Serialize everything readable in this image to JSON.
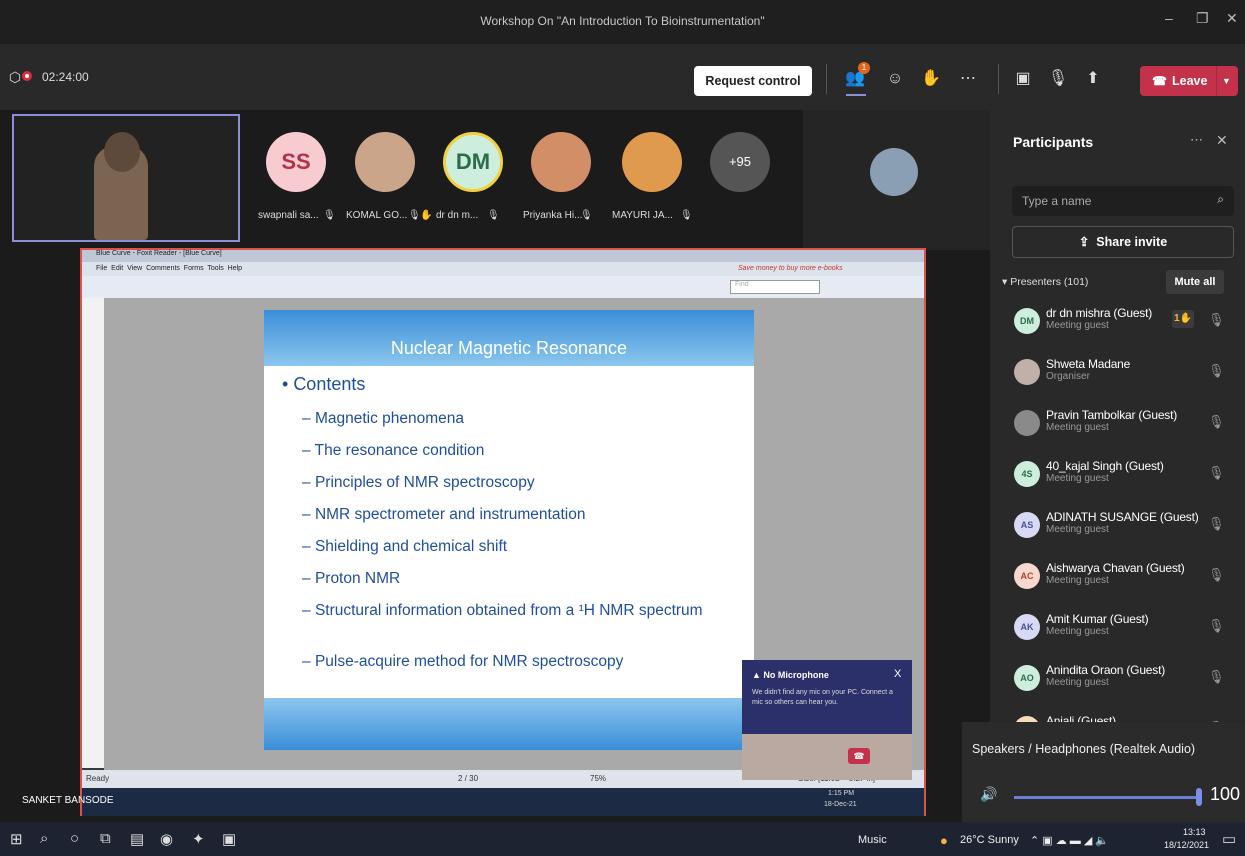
{
  "window": {
    "title": "Workshop On \"An Introduction To Bioinstrumentation\""
  },
  "toolbar": {
    "timer": "02:24:00",
    "request_control": "Request control",
    "leave": "Leave",
    "participants_badge": "1"
  },
  "gallery": {
    "tiles": [
      {
        "initials": "SS",
        "name": "swapnali sa...",
        "bg": "#f8cbd1",
        "fg": "#b0334a"
      },
      {
        "initials": "",
        "name": "KOMAL GO...",
        "bg": "#caa58a",
        "fg": "#fff"
      },
      {
        "initials": "DM",
        "name": "dr dn m...",
        "bg": "#cdeedd",
        "fg": "#2e6b4a"
      },
      {
        "initials": "",
        "name": "Priyanka Hi...",
        "bg": "#d28e66",
        "fg": "#fff"
      },
      {
        "initials": "",
        "name": "MAYURI JA...",
        "bg": "#e09a4e",
        "fg": "#fff"
      }
    ],
    "overflow": "+95"
  },
  "shared": {
    "foxit_title": "Blue Curve - Foxit Reader - [Blue Curve]",
    "menu": [
      "File",
      "Edit",
      "View",
      "Comments",
      "Forms",
      "Tools",
      "Help"
    ],
    "ad_text": "Save money to buy more e-books",
    "find_placeholder": "Find",
    "slide_title": "Nuclear Magnetic Resonance",
    "bullet": "Contents",
    "items": [
      "Magnetic phenomena",
      "The resonance condition",
      "Principles of NMR spectroscopy",
      "NMR spectrometer and instrumentation",
      "Shielding and chemical shift",
      "Proton NMR",
      "Structural information obtained from a ¹H NMR spectrum",
      "Pulse-acquire method for NMR spectroscopy"
    ],
    "status_ready": "Ready",
    "page": "2 / 30",
    "zoom": "75%",
    "size": "Size: [11.02 × 8.27 in]",
    "inner_time": "1:15 PM",
    "inner_date": "18-Dec-21",
    "presenter_label": "SANKET BANSODE",
    "popup": {
      "title": "No Microphone",
      "text": "We didn't find any mic on your PC. Connect a mic so others can hear you.",
      "close": "X"
    }
  },
  "panel": {
    "title": "Participants",
    "search_placeholder": "Type a name",
    "share_invite": "Share invite",
    "presenters": "Presenters (101)",
    "mute_all": "Mute all",
    "people": [
      {
        "initials": "DM",
        "name": "dr dn mishra (Guest)",
        "role": "Meeting guest",
        "bg": "#cdeedd",
        "fg": "#2e6b4a",
        "hand": "1"
      },
      {
        "initials": "",
        "name": "Shweta Madane",
        "role": "Organiser",
        "bg": "#c0b0a8",
        "fg": "#fff",
        "hand": ""
      },
      {
        "initials": "",
        "name": "Pravin Tambolkar (Guest)",
        "role": "Meeting guest",
        "bg": "#8a8a8a",
        "fg": "#fff",
        "hand": ""
      },
      {
        "initials": "4S",
        "name": "40_kajal Singh (Guest)",
        "role": "Meeting guest",
        "bg": "#cdeedd",
        "fg": "#2e6b4a",
        "hand": ""
      },
      {
        "initials": "AS",
        "name": "ADINATH SUSANGE (Guest)",
        "role": "Meeting guest",
        "bg": "#d7d9f5",
        "fg": "#4b4f9e",
        "hand": ""
      },
      {
        "initials": "AC",
        "name": "Aishwarya Chavan (Guest)",
        "role": "Meeting guest",
        "bg": "#f8d7cf",
        "fg": "#a5452e",
        "hand": ""
      },
      {
        "initials": "AK",
        "name": "Amit Kumar (Guest)",
        "role": "Meeting guest",
        "bg": "#d7d9f5",
        "fg": "#4b4f9e",
        "hand": ""
      },
      {
        "initials": "AO",
        "name": "Anindita Oraon (Guest)",
        "role": "Meeting guest",
        "bg": "#cdeedd",
        "fg": "#2e6b4a",
        "hand": ""
      },
      {
        "initials": "A",
        "name": "Anjali (Guest)",
        "role": "",
        "bg": "#f6dcb8",
        "fg": "#8a5a1e",
        "hand": ""
      }
    ]
  },
  "speakers": {
    "label": "Speakers / Headphones (Realtek Audio)",
    "volume": "100",
    "level": 1.0
  },
  "taskbar": {
    "music": "Music",
    "weather": "26°C Sunny",
    "time": "13:13",
    "date": "18/12/2021"
  },
  "colors": {
    "leave": "#c4314b",
    "accent": "#6b7fd7",
    "screen_border": "#d9534f"
  }
}
